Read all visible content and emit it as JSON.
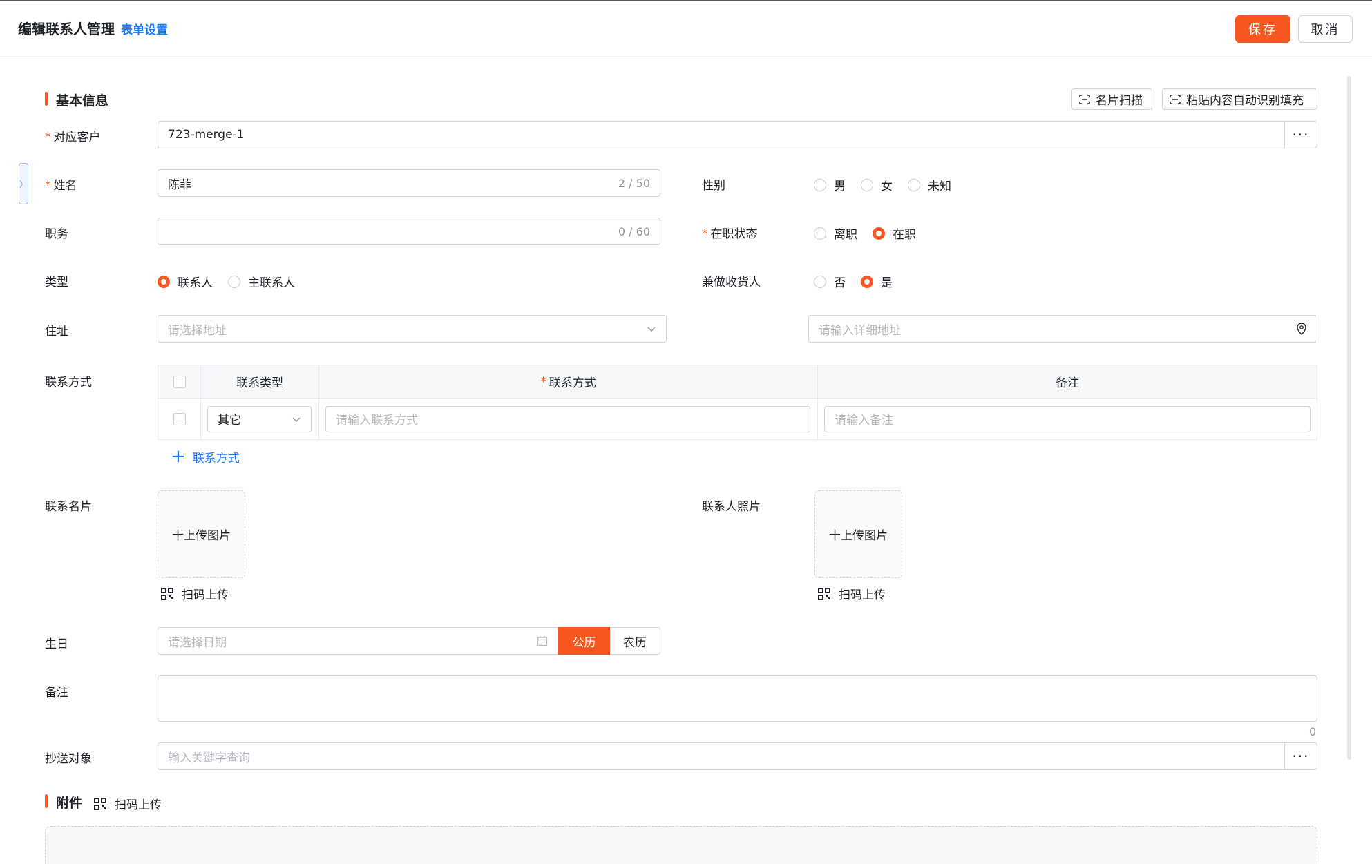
{
  "header": {
    "title": "编辑联系人管理",
    "form_settings": "表单设置",
    "save_label": "保存",
    "cancel_label": "取消"
  },
  "basic_section": {
    "title": "基本信息",
    "card_scan": "名片扫描",
    "paste_fill": "粘贴内容自动识别填充"
  },
  "fields": {
    "customer": {
      "label": "对应客户",
      "value": "723-merge-1"
    },
    "name": {
      "label": "姓名",
      "value": "陈菲",
      "counter": "2 / 50"
    },
    "gender": {
      "label": "性别",
      "options": [
        "男",
        "女",
        "未知"
      ],
      "selected": -1
    },
    "position": {
      "label": "职务",
      "value": "",
      "counter": "0 / 60"
    },
    "employment": {
      "label": "在职状态",
      "options": [
        "离职",
        "在职"
      ],
      "selected": 1
    },
    "type": {
      "label": "类型",
      "options": [
        "联系人",
        "主联系人"
      ],
      "selected": 0
    },
    "receiver": {
      "label": "兼做收货人",
      "options": [
        "否",
        "是"
      ],
      "selected": 1
    },
    "address": {
      "label": "住址",
      "region_placeholder": "请选择地址",
      "detail_placeholder": "请输入详细地址"
    },
    "contact": {
      "label": "联系方式",
      "columns": [
        "联系类型",
        "联系方式",
        "备注"
      ],
      "rows": [
        {
          "type": "其它",
          "method_placeholder": "请输入联系方式",
          "note_placeholder": "请输入备注"
        }
      ],
      "add_label": "联系方式"
    },
    "card": {
      "label": "联系名片",
      "upload_label": "十上传图片",
      "scan_label": "扫码上传"
    },
    "photo": {
      "label": "联系人照片",
      "upload_label": "十上传图片",
      "scan_label": "扫码上传"
    },
    "birthday": {
      "label": "生日",
      "placeholder": "请选择日期",
      "solar": "公历",
      "lunar": "农历"
    },
    "remark": {
      "label": "备注",
      "counter": "0"
    },
    "cc": {
      "label": "抄送对象",
      "placeholder": "输入关键字查询"
    }
  },
  "attachment_section": {
    "title": "附件",
    "scan_label": "扫码上传"
  },
  "colors": {
    "accent": "#f5571f",
    "link": "#1677ff"
  }
}
